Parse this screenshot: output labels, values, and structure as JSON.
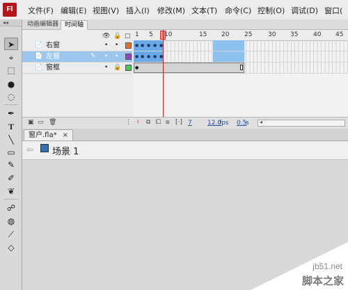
{
  "menubar": {
    "logo": "Fl",
    "items": [
      "文件(F)",
      "编辑(E)",
      "视图(V)",
      "插入(I)",
      "修改(M)",
      "文本(T)",
      "命令(C)",
      "控制(O)",
      "调试(D)",
      "窗口("
    ]
  },
  "toolbox": {
    "collapse": "◂◂"
  },
  "timeline": {
    "tabs": [
      "动画编辑器",
      "时间轴"
    ],
    "active_tab": "时间轴",
    "ruler": [
      "1",
      "5",
      "10",
      "15",
      "20",
      "25",
      "30",
      "35",
      "40",
      "45"
    ],
    "layers": [
      {
        "name": "右窗",
        "color": "#e8731f",
        "selected": false
      },
      {
        "name": "左窗",
        "color": "#9b3fc7",
        "selected": true
      },
      {
        "name": "窗框",
        "color": "#3fcf4f",
        "selected": false
      }
    ],
    "status": {
      "frame": "7",
      "fps": "12.0",
      "fps_unit": "fps",
      "time": "0.5",
      "time_unit": "s"
    }
  },
  "document": {
    "tab": "窗户.fla*",
    "close": "×",
    "scene": "场景 1"
  },
  "watermark": {
    "url": "jb51.net",
    "site": "脚本之家"
  },
  "colors": {
    "accent_selection": "#9cc6ee",
    "frame_span": "#6aa9e8",
    "playhead": "#cc2222"
  }
}
